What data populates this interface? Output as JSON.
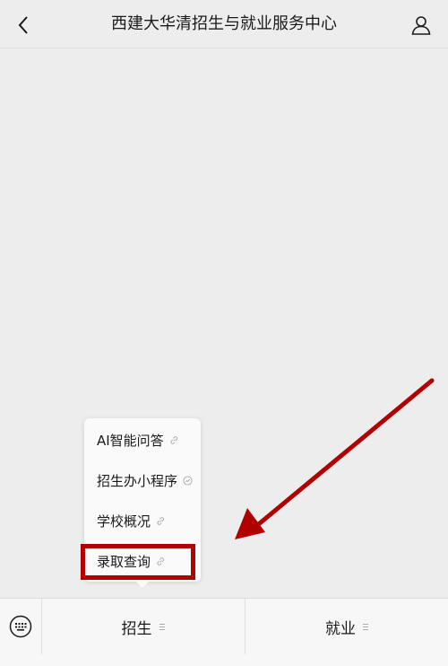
{
  "header": {
    "title": "西建大华清招生与就业服务中心",
    "back_icon": "back-chevron-icon",
    "profile_icon": "user-profile-icon"
  },
  "popup_menu": {
    "items": [
      {
        "label": "AI智能问答",
        "icon": "link-icon"
      },
      {
        "label": "招生办小程序",
        "icon": "mini-program-icon"
      },
      {
        "label": "学校概况",
        "icon": "link-icon"
      },
      {
        "label": "录取查询",
        "icon": "link-icon",
        "highlighted": true
      }
    ]
  },
  "bottom_bar": {
    "keyboard_icon": "keyboard-icon",
    "tabs": [
      {
        "label": "招生",
        "icon": "menu-lines-icon"
      },
      {
        "label": "就业",
        "icon": "menu-lines-icon"
      }
    ]
  },
  "colors": {
    "background": "#ededed",
    "annotation": "#b00000",
    "popup_bg": "#fafafa"
  }
}
